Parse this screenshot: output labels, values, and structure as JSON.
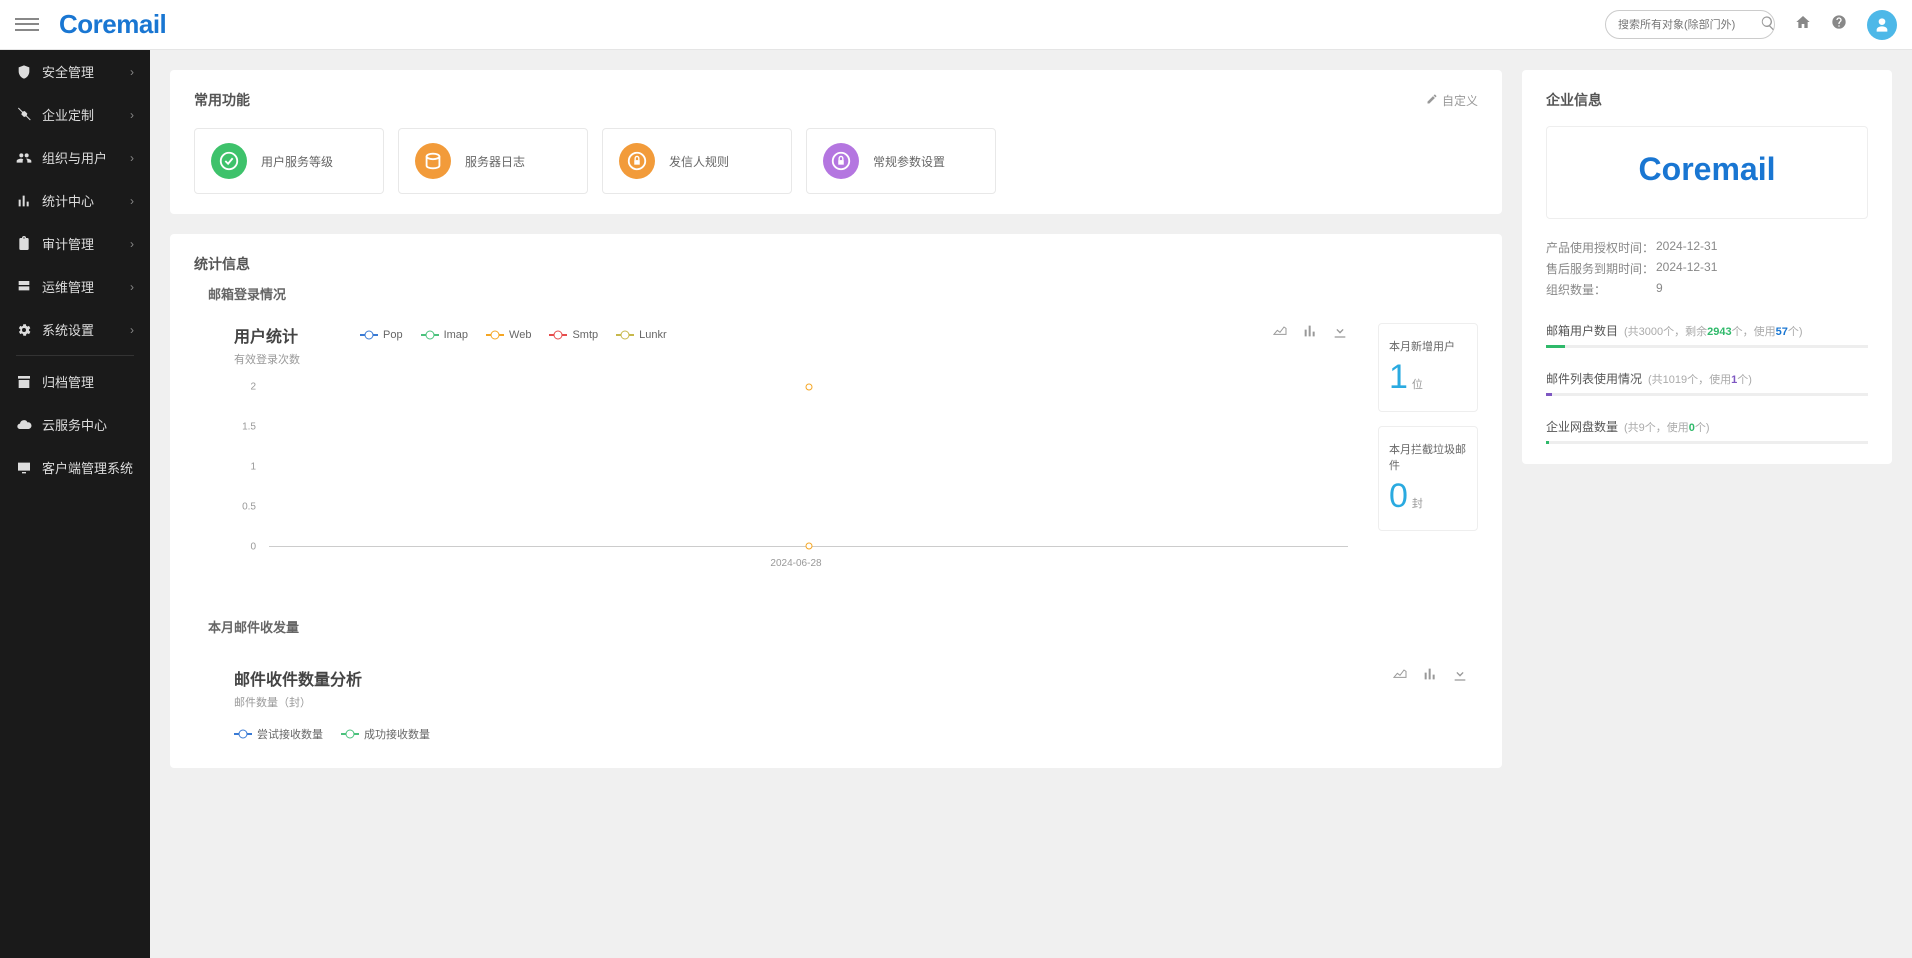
{
  "topbar": {
    "logo": "Coremail",
    "search_placeholder": "搜索所有对象(除部门外)"
  },
  "sidebar": {
    "items": [
      {
        "label": "安全管理",
        "icon": "shield",
        "expandable": true
      },
      {
        "label": "企业定制",
        "icon": "tools",
        "expandable": true
      },
      {
        "label": "组织与用户",
        "icon": "users",
        "expandable": true
      },
      {
        "label": "统计中心",
        "icon": "chart",
        "expandable": true
      },
      {
        "label": "审计管理",
        "icon": "clipboard",
        "expandable": true
      },
      {
        "label": "运维管理",
        "icon": "server",
        "expandable": true
      },
      {
        "label": "系统设置",
        "icon": "gear",
        "expandable": true
      }
    ],
    "secondary": [
      {
        "label": "归档管理",
        "icon": "archive"
      },
      {
        "label": "云服务中心",
        "icon": "cloud"
      },
      {
        "label": "客户端管理系统",
        "icon": "desktop"
      }
    ]
  },
  "common_functions": {
    "title": "常用功能",
    "customize": "自定义",
    "tiles": [
      {
        "label": "用户服务等级",
        "color": "#3ec26b"
      },
      {
        "label": "服务器日志",
        "color": "#f29b3a"
      },
      {
        "label": "发信人规则",
        "color": "#f29b3a"
      },
      {
        "label": "常规参数设置",
        "color": "#b476e0"
      }
    ]
  },
  "stats": {
    "title": "统计信息",
    "login_section": "邮箱登录情况",
    "chart1": {
      "title": "用户统计",
      "subtitle": "有效登录次数",
      "legend": [
        {
          "name": "Pop",
          "color": "#3a7bd5"
        },
        {
          "name": "Imap",
          "color": "#4bc27d"
        },
        {
          "name": "Web",
          "color": "#f5a623"
        },
        {
          "name": "Smtp",
          "color": "#e64c4c"
        },
        {
          "name": "Lunkr",
          "color": "#c7b84b"
        }
      ],
      "y_ticks": [
        "2",
        "1.5",
        "1",
        "0.5",
        "0"
      ],
      "x_label": "2024-06-28"
    },
    "side": [
      {
        "label": "本月新增用户",
        "value": "1",
        "unit": "位"
      },
      {
        "label": "本月拦截垃圾邮件",
        "value": "0",
        "unit": "封"
      }
    ],
    "mail_section": "本月邮件收发量",
    "chart2": {
      "title": "邮件收件数量分析",
      "subtitle": "邮件数量（封）",
      "legend": [
        {
          "name": "尝试接收数量",
          "color": "#3a7bd5"
        },
        {
          "name": "成功接收数量",
          "color": "#4bc27d"
        }
      ]
    }
  },
  "enterprise": {
    "title": "企业信息",
    "logo": "Coremail",
    "rows": [
      {
        "key": "产品使用授权时间：",
        "val": "2024-12-31"
      },
      {
        "key": "售后服务到期时间：",
        "val": "2024-12-31"
      },
      {
        "key": "组织数量：",
        "val": "9"
      }
    ],
    "usage": [
      {
        "title": "邮箱用户数目",
        "prefix": "(共",
        "total": "3000",
        "mid": "个，剩余",
        "remain": "2943",
        "mid2": "个，使用",
        "used": "57",
        "suffix": "个)",
        "highlight": "green",
        "bar_color": "#2fb96a",
        "bar_width": "6%"
      },
      {
        "title": "邮件列表使用情况",
        "prefix": "(共",
        "total": "1019",
        "mid": "个，使用",
        "used": "1",
        "suffix": "个)",
        "highlight": "purple",
        "bar_color": "#7e57c2",
        "bar_width": "2%"
      },
      {
        "title": "企业网盘数量",
        "prefix": "(共",
        "total": "9",
        "mid": "个，使用",
        "used": "0",
        "suffix": "个)",
        "highlight": "green",
        "bar_color": "#2fb96a",
        "bar_width": "1%"
      }
    ]
  },
  "chart_data": [
    {
      "type": "line",
      "title": "用户统计",
      "subtitle": "有效登录次数",
      "x": [
        "2024-06-28"
      ],
      "series": [
        {
          "name": "Pop",
          "values": [
            null
          ]
        },
        {
          "name": "Imap",
          "values": [
            null
          ]
        },
        {
          "name": "Web",
          "values": [
            2
          ]
        },
        {
          "name": "Smtp",
          "values": [
            null
          ]
        },
        {
          "name": "Lunkr",
          "values": [
            null
          ]
        }
      ],
      "ylim": [
        0,
        2
      ],
      "ylabel": "有效登录次数"
    },
    {
      "type": "line",
      "title": "邮件收件数量分析",
      "subtitle": "邮件数量（封）",
      "series": [
        {
          "name": "尝试接收数量",
          "values": []
        },
        {
          "name": "成功接收数量",
          "values": []
        }
      ]
    }
  ]
}
